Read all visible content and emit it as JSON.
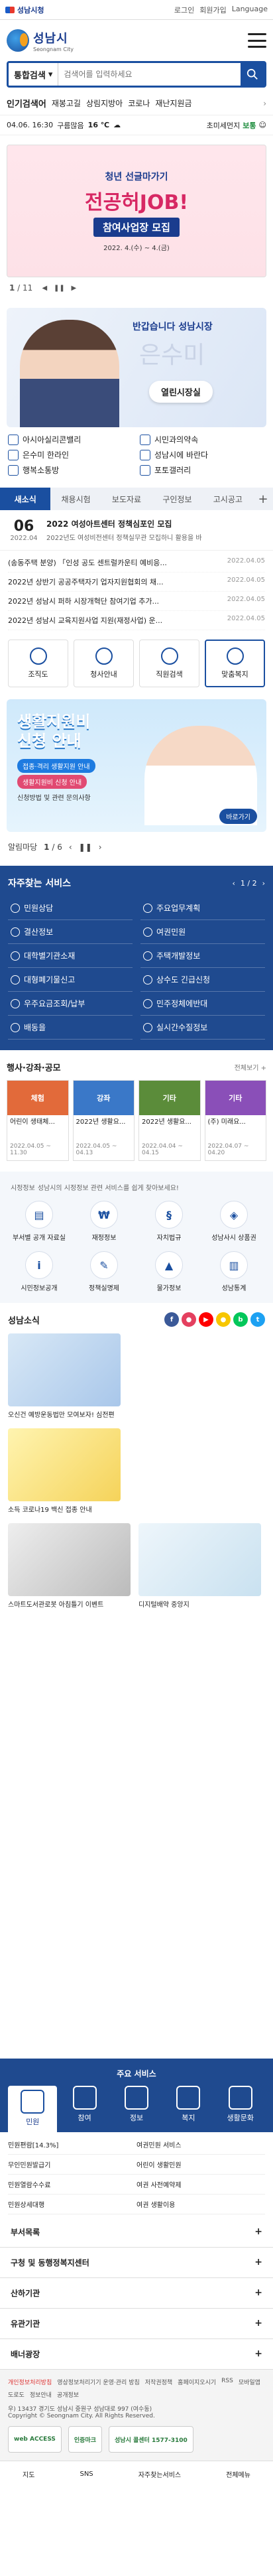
{
  "topbar": {
    "site": "성남시청",
    "links": [
      "로그인",
      "회원가입",
      "Language"
    ]
  },
  "header": {
    "logo": "성남시",
    "logo_en": "Seongnam City"
  },
  "search": {
    "select": "통합검색",
    "placeholder": "검색어를 입력하세요"
  },
  "quick": {
    "title": "인기검색어",
    "items": [
      "재봉고길",
      "상림지방아",
      "코로나",
      "재난지원금"
    ]
  },
  "weather": {
    "date": "04.06. 16:30",
    "area": "구름많음",
    "temp": "16 ℃",
    "dust_label": "초미세먼지",
    "dust_value": "보통"
  },
  "banner": {
    "line1": "청년 선글마가기",
    "line2": "전공허JOB!",
    "line3": "참여사업장 모집",
    "line4": "2022. 4.(수) ~ 4.(금)"
  },
  "banner_pager": {
    "current": "1",
    "total": "11"
  },
  "mayor": {
    "greet": "반갑습니다 성남시장",
    "sig": "은수미",
    "btn": "열린시장실"
  },
  "mayor_links": [
    "아시아실리콘밸리",
    "시민과의약속",
    "은수미 한라인",
    "성남시에 바란다",
    "행복소통방",
    "포토갤러리"
  ],
  "news": {
    "tabs": [
      "새소식",
      "채용시험",
      "보도자료",
      "구인정보",
      "고시공고"
    ],
    "top": {
      "day": "06",
      "ym": "2022.04",
      "title": "2022 여성아트센터 정책심포인 모집",
      "desc": "2022년도 여성비전센터 정책실무관 모집하니 활용을 바"
    },
    "rows": [
      {
        "t": "(송동주택 분양) 「인성 공도 센트럴카운티 예비응...",
        "d": "2022.04.05"
      },
      {
        "t": "2022년 상반기 공공주택자기 업자지원협회의 채...",
        "d": "2022.04.05"
      },
      {
        "t": "2022년 성남시 퍼하 시장개혁단 참여기업 추가...",
        "d": "2022.04.05"
      },
      {
        "t": "2022년 성남시 교육지원사업 지원(재정사업) 운...",
        "d": "2022.04.05"
      }
    ]
  },
  "quick_icons": [
    "조직도",
    "청사안내",
    "직원검색",
    "맞춤복지"
  ],
  "promo": {
    "line1": "생활지원비",
    "line2": "신청 안내",
    "tag1": "접종·격리 생활지원 안내",
    "tag2": "생활지원비 신청 안내",
    "note": "신청방법 및 관련 문의사항",
    "btn": "바로가기"
  },
  "popup_pager": {
    "label": "알림마당",
    "current": "1",
    "total": "6"
  },
  "freq": {
    "title": "자주찾는 서비스",
    "page": "1 / 2",
    "items": [
      "민원상담",
      "주요업무계획",
      "결산정보",
      "여권민원",
      "대학별기관소재",
      "주택개발정보",
      "대형폐기물신고",
      "상수도 긴급신청",
      "우주요금조회/납부",
      "민주정체에반대",
      "배동을",
      "실시간수질정보"
    ]
  },
  "events": {
    "title": "행사·강좌·공모",
    "more": "전체보기 +",
    "items": [
      {
        "thumb": "체험",
        "color": "#e26a3a",
        "txt": "어린이 생태체...",
        "dt": "2022.04.05 ~ 11.30"
      },
      {
        "thumb": "강좌",
        "color": "#3a78c8",
        "txt": "2022년 생활요...",
        "dt": "2022.04.05 ~ 04.13"
      },
      {
        "thumb": "기타",
        "color": "#5b8c3a",
        "txt": "2022년 생활요...",
        "dt": "2022.04.04 ~ 04.15"
      },
      {
        "thumb": "기타",
        "color": "#8a4fb8",
        "txt": "(주) 미래요...",
        "dt": "2022.04.07 ~ 04.20"
      }
    ]
  },
  "city": {
    "title": "시정정보",
    "sub": "성남시의 시정정보 관련 서비스를 쉽게 찾아보세요!",
    "items": [
      "부서별 공개 자료실",
      "재정정보",
      "자치법규",
      "성남사시 상품권",
      "시민정보공개",
      "정책실명제",
      "물가정보",
      "성남통계"
    ]
  },
  "sns": {
    "title": "성남소식",
    "icons": [
      "f",
      "●",
      "▶",
      "●",
      "b",
      "t"
    ],
    "items": [
      {
        "cap": "오신건 예방운동법만 모여보자! 심전편"
      },
      {
        "cap": "소득 코로나19 백신 접종 안내"
      },
      {
        "cap": "소득 코로나19 백신 접종 안내"
      },
      {
        "cap": "스마트도서관로봇 아침틀기 이벤트"
      },
      {
        "cap": "디지털배약 중앙지"
      }
    ]
  },
  "main_svc": {
    "title": "주요 서비스",
    "tabs": [
      "민원",
      "참여",
      "정보",
      "복지",
      "생활문화"
    ],
    "items": [
      "민원편람[14.3%]",
      "여권민원 서비스",
      "무인민원발급기",
      "어린이 생활민원",
      "민원열람수수료",
      "여권 사전예약제",
      "민원상세대행",
      "여권 생활이용"
    ]
  },
  "accordions": [
    "부서목록",
    "구청 및 동행정복지센터",
    "산하기관",
    "유관기관",
    "배너광장"
  ],
  "footer": {
    "links": [
      "개인정보처리방침",
      "영상정보처리기기 운영·관리 방침",
      "저작권정책",
      "홈페이지오시기",
      "RSS",
      "모바일앱",
      "도로도",
      "정보안내",
      "공개정보"
    ],
    "address": "우) 13437 경기도 성남시 중원구 성남대로 997 (여수동)",
    "copy": "Copyright © Seongnam City. All Rights Reserved.",
    "badges": [
      "web ACCESS",
      "인증마크",
      "성남시 콜센터 1577-3100"
    ]
  },
  "bottom": [
    "지도",
    "SNS",
    "자주찾는서비스",
    "전체메뉴"
  ]
}
